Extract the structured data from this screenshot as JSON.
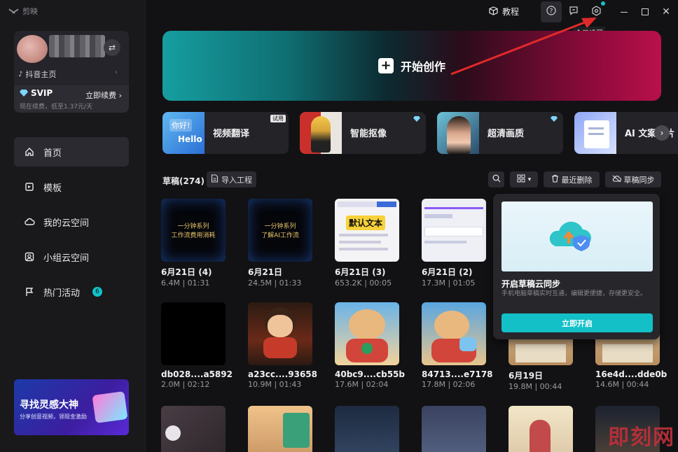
{
  "app": {
    "name": "剪映"
  },
  "topbar": {
    "tutorial_label": "教程",
    "tooltip": "全局设置"
  },
  "user": {
    "douyin_label": "抖音主页",
    "svip_label": "SVIP",
    "renew_label": "立即续费",
    "svip_sub": "现在续费，低至1.37元/天"
  },
  "sidebar": {
    "items": [
      {
        "label": "首页",
        "icon": "home-icon",
        "active": true
      },
      {
        "label": "模板",
        "icon": "template-icon"
      },
      {
        "label": "我的云空间",
        "icon": "cloud-icon"
      },
      {
        "label": "小组云空间",
        "icon": "group-icon"
      },
      {
        "label": "热门活动",
        "icon": "flag-icon",
        "badge": "6"
      }
    ],
    "promo": {
      "title": "寻找灵感大神",
      "subtitle": "分享创意视频，领现金激励"
    }
  },
  "hero": {
    "label": "开始创作"
  },
  "tools": [
    {
      "label": "视频翻译",
      "tag": "试用",
      "thumb_text_1": "你好!",
      "thumb_text_2": "Hello"
    },
    {
      "label": "智能抠像",
      "tag": "vip"
    },
    {
      "label": "超清画质",
      "tag": "vip"
    },
    {
      "label": "AI 文案成片",
      "tag": "vip"
    }
  ],
  "drafts": {
    "title": "草稿(274)",
    "import_label": "导入工程",
    "recent_delete_label": "最近删除",
    "sync_label": "草稿同步",
    "items": [
      {
        "title": "6月21日 (4)",
        "meta": "6.4M | 01:31",
        "thumb_line1": "一分钟系列",
        "thumb_line2": "工作流费用消耗"
      },
      {
        "title": "6月21日",
        "meta": "24.5M | 01:33",
        "thumb_line1": "一分钟系列",
        "thumb_line2": "了解AI工作流"
      },
      {
        "title": "6月21日 (3)",
        "meta": "653.2K | 00:05",
        "thumb_label": "默认文本"
      },
      {
        "title": "6月21日 (2)",
        "meta": "17.3M | 01:05"
      },
      {
        "title": "db028....a5892",
        "meta": "2.0M | 02:12"
      },
      {
        "title": "a23cc....93658",
        "meta": "10.9M | 01:43"
      },
      {
        "title": "40bc9....cb55b",
        "meta": "17.6M | 02:04"
      },
      {
        "title": "84713....e7178",
        "meta": "17.8M | 02:06"
      },
      {
        "title": "6月19日",
        "meta": "19.8M | 00:44"
      },
      {
        "title": "16e4d....dde0b",
        "meta": "14.6M | 00:44"
      }
    ]
  },
  "popup": {
    "title": "开启草稿云同步",
    "subtitle": "手机电脑草稿实时互通，编辑更便捷，存储更安全。",
    "button": "立即开启"
  },
  "watermark": "即刻网",
  "colors": {
    "accent": "#14c0c8",
    "hero_left": "#169ea0",
    "hero_right": "#b8104a",
    "arrow": "#e02a2a"
  }
}
